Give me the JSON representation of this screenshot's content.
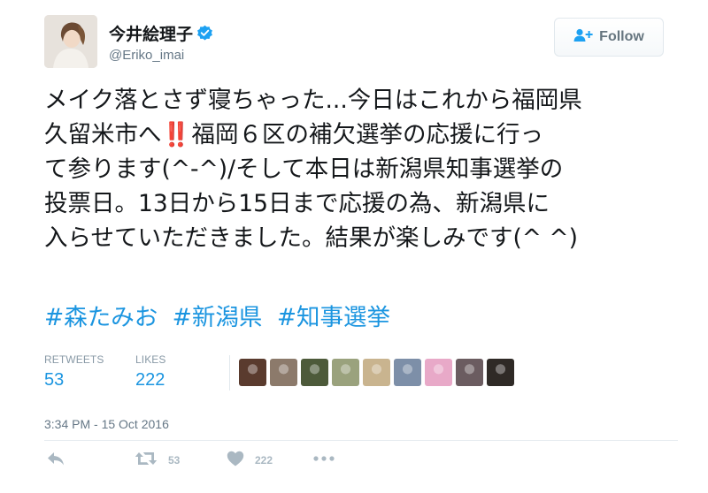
{
  "user": {
    "display_name": "今井絵理子",
    "screen_name": "@Eriko_imai",
    "verified": true
  },
  "follow_button": {
    "label": "Follow"
  },
  "tweet": {
    "lines": [
      "メイク落とさず寝ちゃった...今日はこれから福岡県",
      "久留米市へ",
      "福岡６区の補欠選挙の応援に行っ",
      "て参ります(^-^)/そして本日は新潟県知事選挙の",
      "投票日。13日から15日まで応援の為、新潟県に",
      "入らせていただきました。結果が楽しみです(^ ^)"
    ],
    "emoji": "‼️",
    "hashtags": [
      "#森たみお",
      "#新潟県",
      "#知事選挙"
    ]
  },
  "stats": {
    "retweets_label": "RETWEETS",
    "retweets_value": "53",
    "likes_label": "LIKES",
    "likes_value": "222"
  },
  "likers": [
    {
      "name": "liker-1",
      "color": "#5a3b2e"
    },
    {
      "name": "liker-2",
      "color": "#8c7a6b"
    },
    {
      "name": "liker-3",
      "color": "#4d5a3a"
    },
    {
      "name": "liker-4",
      "color": "#9aa27d"
    },
    {
      "name": "liker-5",
      "color": "#c9b48f"
    },
    {
      "name": "liker-6",
      "color": "#7d8fa8"
    },
    {
      "name": "liker-7",
      "color": "#e8a9c8"
    },
    {
      "name": "liker-8",
      "color": "#6b5c60"
    },
    {
      "name": "liker-9",
      "color": "#2f2a26"
    }
  ],
  "timestamp": "3:34 PM - 15 Oct 2016",
  "actions": {
    "retweet_count": "53",
    "like_count": "222"
  },
  "colors": {
    "link": "#1b95e0",
    "muted": "#657786",
    "icon": "#aab8c2",
    "emoji_red": "#dd2e44"
  },
  "icons": [
    "verified-badge-icon",
    "follow-person-plus-icon",
    "reply-icon",
    "retweet-icon",
    "heart-icon",
    "more-dots-icon"
  ]
}
